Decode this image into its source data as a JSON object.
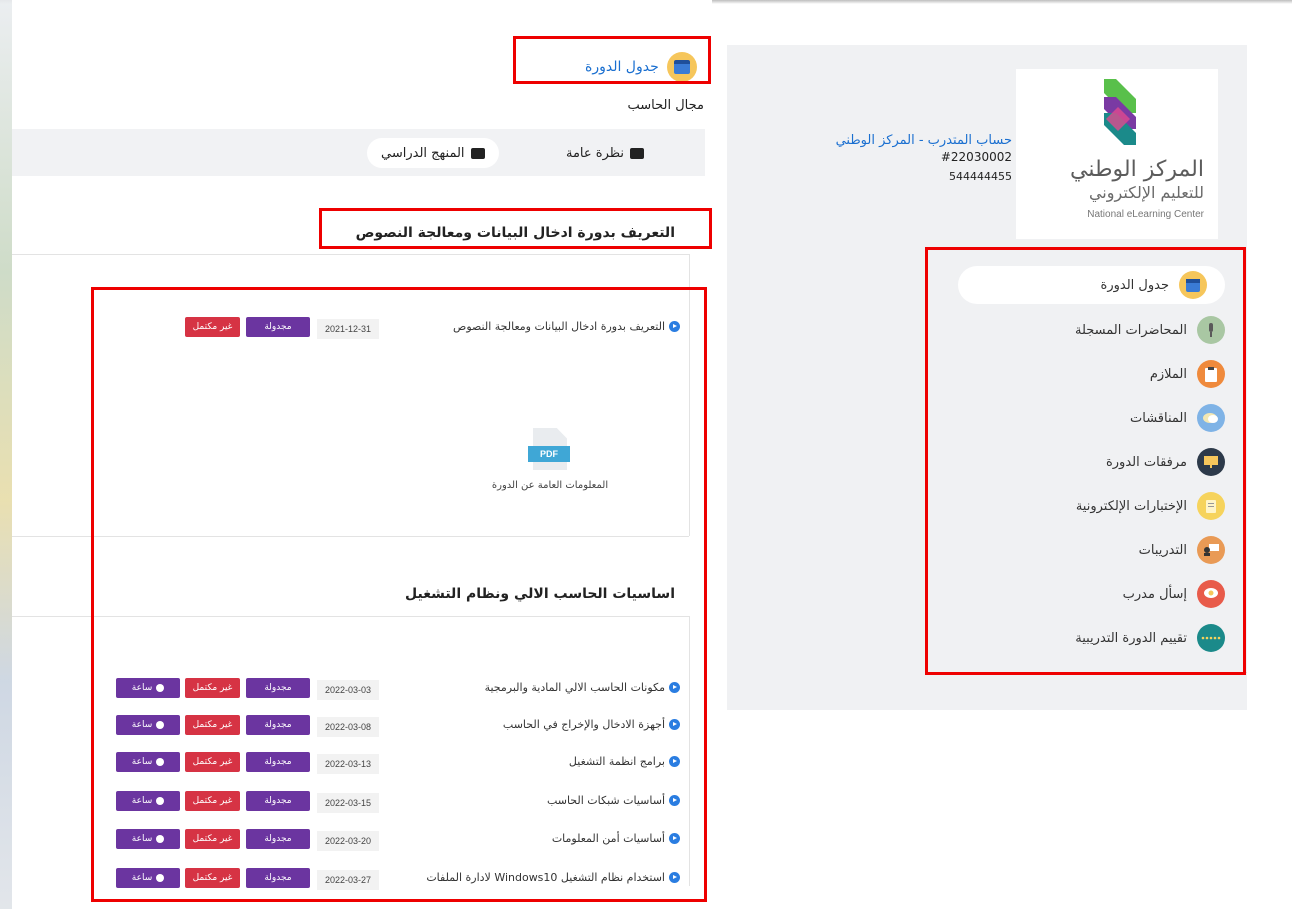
{
  "page": {
    "schedule_title": "جدول الدورة",
    "field": "مجال الحاسب"
  },
  "tabs": {
    "overview": "نظرة عامة",
    "curriculum": "المنهج الدراسي"
  },
  "sections": [
    {
      "title": "التعريف بدورة ادخال البيانات ومعالجة النصوص",
      "rows": [
        {
          "title": "التعريف بدورة ادخال البيانات ومعالجة النصوص",
          "date": "2021-12-31",
          "status": "مجدولة",
          "completion": "غير مكتمل"
        }
      ],
      "attachment": {
        "type": "PDF",
        "label": "المعلومات العامة عن الدورة"
      }
    },
    {
      "title": "اساسيات الحاسب الالي ونظام التشغيل",
      "rows": [
        {
          "title": "مكونات الحاسب الالي المادية والبرمجية",
          "date": "2022-03-03",
          "status": "مجدولة",
          "completion": "غير مكتمل",
          "hour": "ساعة"
        },
        {
          "title": "أجهزة الادخال والإخراج في الحاسب",
          "date": "2022-03-08",
          "status": "مجدولة",
          "completion": "غير مكتمل",
          "hour": "ساعة"
        },
        {
          "title": "برامج انظمة التشغيل",
          "date": "2022-03-13",
          "status": "مجدولة",
          "completion": "غير مكتمل",
          "hour": "ساعة"
        },
        {
          "title": "أساسيات شبكات الحاسب",
          "date": "2022-03-15",
          "status": "مجدولة",
          "completion": "غير مكتمل",
          "hour": "ساعة"
        },
        {
          "title": "أساسيات أمن المعلومات",
          "date": "2022-03-20",
          "status": "مجدولة",
          "completion": "غير مكتمل",
          "hour": "ساعة"
        },
        {
          "title": "استخدام نظام التشغيل Windows10 لادارة الملفات",
          "date": "2022-03-27",
          "status": "مجدولة",
          "completion": "غير مكتمل",
          "hour": "ساعة"
        }
      ]
    }
  ],
  "sidebar": {
    "logo": {
      "ar_line1": "المركز الوطني",
      "ar_line2": "للتعليم الإلكتروني",
      "en": "National eLearning Center"
    },
    "account": {
      "name": "حساب المتدرب - المركز الوطني",
      "id": "#22030002",
      "phone": "544444455"
    },
    "menu": [
      {
        "label": "جدول الدورة",
        "icon": "calendar-icon",
        "color": "#f6c65b"
      },
      {
        "label": "المحاضرات المسجلة",
        "icon": "microphone-icon",
        "color": "#a9c7a3"
      },
      {
        "label": "الملازم",
        "icon": "clipboard-icon",
        "color": "#ef8a3c"
      },
      {
        "label": "المناقشات",
        "icon": "chat-icon",
        "color": "#7fb3e6"
      },
      {
        "label": "مرفقات الدورة",
        "icon": "attachment-icon",
        "color": "#2d3a4a"
      },
      {
        "label": "الإختبارات الإلكترونية",
        "icon": "exam-icon",
        "color": "#f6d35c"
      },
      {
        "label": "التدريبات",
        "icon": "training-icon",
        "color": "#e99a55"
      },
      {
        "label": "إسأل مدرب",
        "icon": "ask-trainer-icon",
        "color": "#e85b4a"
      },
      {
        "label": "تقييم الدورة التدريبية",
        "icon": "rating-icon",
        "color": "#1b8a8a"
      }
    ]
  }
}
